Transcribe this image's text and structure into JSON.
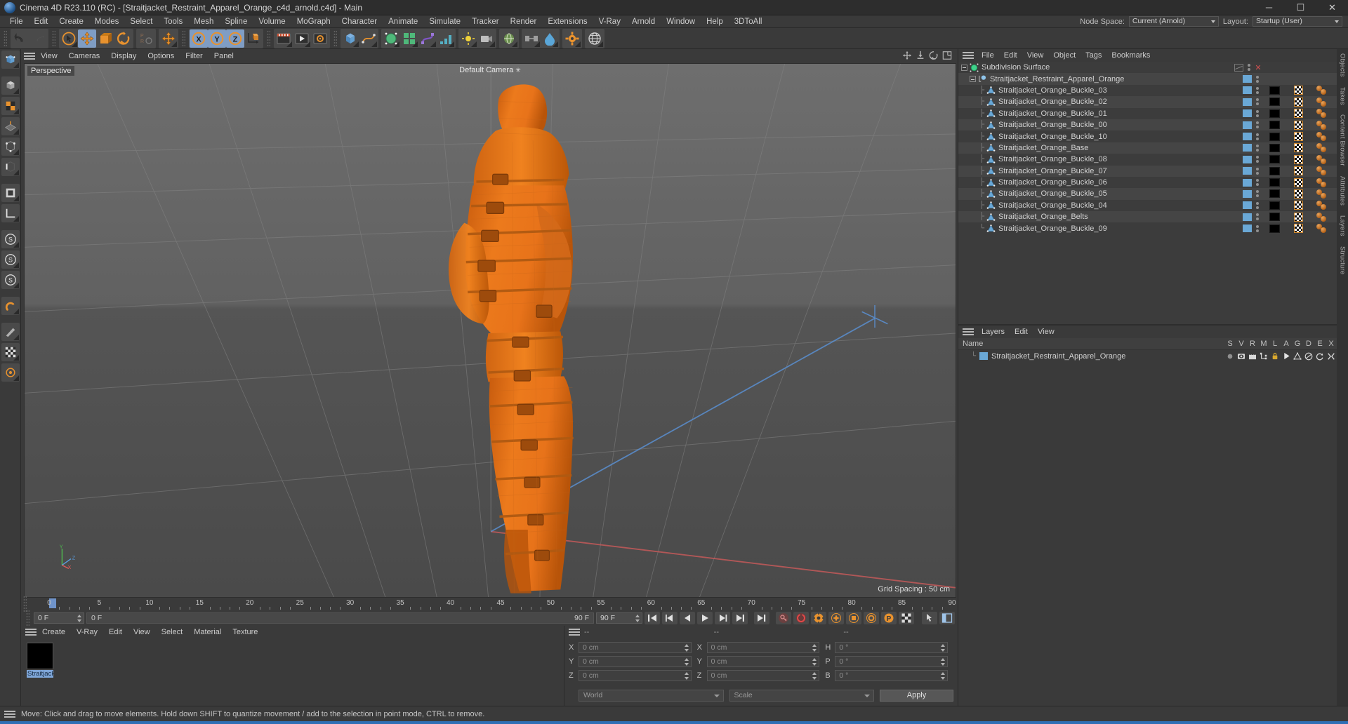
{
  "window": {
    "title": "Cinema 4D R23.110 (RC) - [Straitjacket_Restraint_Apparel_Orange_c4d_arnold.c4d] - Main",
    "minimize": "─",
    "maximize": "☐",
    "close": "✕"
  },
  "menubar": {
    "items": [
      "File",
      "Edit",
      "Create",
      "Modes",
      "Select",
      "Tools",
      "Mesh",
      "Spline",
      "Volume",
      "MoGraph",
      "Character",
      "Animate",
      "Simulate",
      "Tracker",
      "Render",
      "Extensions",
      "V-Ray",
      "Arnold",
      "Window",
      "Help",
      "3DToAll"
    ],
    "node_space_label": "Node Space:",
    "node_space_value": "Current (Arnold)",
    "layout_label": "Layout:",
    "layout_value": "Startup (User)"
  },
  "viewport": {
    "menu": [
      "View",
      "Cameras",
      "Display",
      "Options",
      "Filter",
      "Panel"
    ],
    "label": "Perspective",
    "camera": "Default Camera",
    "grid_spacing": "Grid Spacing : 50 cm",
    "axis": {
      "x": "X",
      "y": "Y",
      "z": "Z"
    }
  },
  "timeline": {
    "ticks": [
      "0",
      "5",
      "10",
      "15",
      "20",
      "25",
      "30",
      "35",
      "40",
      "45",
      "50",
      "55",
      "60",
      "65",
      "70",
      "75",
      "80",
      "85",
      "90"
    ],
    "current_frame": "0 F",
    "track_start": "0 F",
    "track_end": "90 F",
    "range_end": "90 F",
    "fps_field": "0 F"
  },
  "materials": {
    "menu": [
      "Create",
      "V-Ray",
      "Edit",
      "View",
      "Select",
      "Material",
      "Texture"
    ],
    "items": [
      {
        "name": "Straitjack",
        "color": "#000000"
      }
    ]
  },
  "coordinates": {
    "headers": [
      "--",
      "--",
      "--"
    ],
    "rows": [
      {
        "pos_label": "X",
        "pos_value": "0 cm",
        "size_label": "X",
        "size_value": "0 cm",
        "rot_label": "H",
        "rot_value": "0 °"
      },
      {
        "pos_label": "Y",
        "pos_value": "0 cm",
        "size_label": "Y",
        "size_value": "0 cm",
        "rot_label": "P",
        "rot_value": "0 °"
      },
      {
        "pos_label": "Z",
        "pos_value": "0 cm",
        "size_label": "Z",
        "size_value": "0 cm",
        "rot_label": "B",
        "rot_value": "0 °"
      }
    ],
    "system": "World",
    "mode": "Scale",
    "apply": "Apply"
  },
  "object_manager": {
    "menu": [
      "File",
      "Edit",
      "View",
      "Object",
      "Tags",
      "Bookmarks"
    ],
    "items": [
      {
        "name": "Subdivision Surface",
        "depth": 0,
        "icon": "subdivision-surface-icon",
        "layer": "none",
        "tags": false,
        "expander": true
      },
      {
        "name": "Straitjacket_Restraint_Apparel_Orange",
        "depth": 1,
        "icon": "null-object-icon",
        "layer": "blue",
        "tags": false,
        "expander": true
      },
      {
        "name": "Straitjacket_Orange_Buckle_03",
        "depth": 2,
        "icon": "polygon-object-icon",
        "layer": "blue",
        "tags": true
      },
      {
        "name": "Straitjacket_Orange_Buckle_02",
        "depth": 2,
        "icon": "polygon-object-icon",
        "layer": "blue",
        "tags": true
      },
      {
        "name": "Straitjacket_Orange_Buckle_01",
        "depth": 2,
        "icon": "polygon-object-icon",
        "layer": "blue",
        "tags": true
      },
      {
        "name": "Straitjacket_Orange_Buckle_00",
        "depth": 2,
        "icon": "polygon-object-icon",
        "layer": "blue",
        "tags": true
      },
      {
        "name": "Straitjacket_Orange_Buckle_10",
        "depth": 2,
        "icon": "polygon-object-icon",
        "layer": "blue",
        "tags": true
      },
      {
        "name": "Straitjacket_Orange_Base",
        "depth": 2,
        "icon": "polygon-object-icon",
        "layer": "blue",
        "tags": true
      },
      {
        "name": "Straitjacket_Orange_Buckle_08",
        "depth": 2,
        "icon": "polygon-object-icon",
        "layer": "blue",
        "tags": true
      },
      {
        "name": "Straitjacket_Orange_Buckle_07",
        "depth": 2,
        "icon": "polygon-object-icon",
        "layer": "blue",
        "tags": true
      },
      {
        "name": "Straitjacket_Orange_Buckle_06",
        "depth": 2,
        "icon": "polygon-object-icon",
        "layer": "blue",
        "tags": true
      },
      {
        "name": "Straitjacket_Orange_Buckle_05",
        "depth": 2,
        "icon": "polygon-object-icon",
        "layer": "blue",
        "tags": true
      },
      {
        "name": "Straitjacket_Orange_Buckle_04",
        "depth": 2,
        "icon": "polygon-object-icon",
        "layer": "blue",
        "tags": true
      },
      {
        "name": "Straitjacket_Orange_Belts",
        "depth": 2,
        "icon": "polygon-object-icon",
        "layer": "blue",
        "tags": true
      },
      {
        "name": "Straitjacket_Orange_Buckle_09",
        "depth": 2,
        "icon": "polygon-object-icon",
        "layer": "blue",
        "tags": true,
        "last": true
      }
    ]
  },
  "layers_manager": {
    "menu": [
      "Layers",
      "Edit",
      "View"
    ],
    "columns": [
      "Name",
      "S",
      "V",
      "R",
      "M",
      "L",
      "A",
      "G",
      "D",
      "E",
      "X"
    ],
    "rows": [
      {
        "name": "Straitjacket_Restraint_Apparel_Orange",
        "color": "#6aa8d6"
      }
    ]
  },
  "right_tabs": [
    "Objects",
    "Takes",
    "Content Browser",
    "Attributes",
    "Layers",
    "Structure"
  ],
  "statusbar": {
    "message": "Move: Click and drag to move elements. Hold down SHIFT to quantize movement / add to the selection in point mode, CTRL to remove."
  },
  "colors": {
    "model_orange": "#E8761E",
    "accent_blue": "#7f9dc4",
    "layer_blue": "#6aa8d6",
    "panel_bg": "#3a3a3a"
  }
}
